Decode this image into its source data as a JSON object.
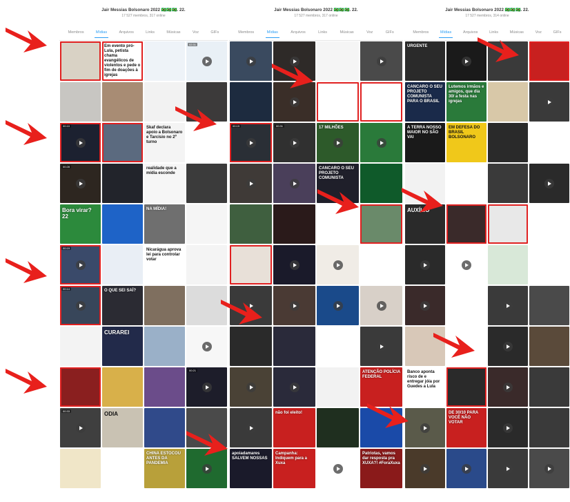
{
  "panels": [
    {
      "title": "Jair Messias Bolsonaro 2022 🇧🇷🇧🇷🇧🇷. 22.",
      "subtitle": "17 527 membros, 317 online",
      "tabs": [
        "Membros",
        "Mídias",
        "Arquivos",
        "Links",
        "Músicas",
        "Voz",
        "GIFs"
      ],
      "active_tab": "Mídias",
      "cells": [
        {
          "bg": "#d9d2c5",
          "text": "",
          "hl": true,
          "video": false
        },
        {
          "bg": "#ffffff",
          "text": "Em evento pró-Lula, petista chama evangélicos de violentos e pede o fim de doações à igrejas",
          "dark": true,
          "hl": true,
          "video": false
        },
        {
          "bg": "#eef3f8",
          "text": "",
          "video": false
        },
        {
          "bg": "#e9f0f6",
          "text": "",
          "video": true,
          "dur": "02:31"
        },
        {
          "bg": "#c8c6c2",
          "text": "",
          "video": false
        },
        {
          "bg": "#a88c74",
          "text": "",
          "video": false
        },
        {
          "bg": "#f2f2f2",
          "text": "",
          "video": false
        },
        {
          "bg": "#3c3a3a",
          "text": "",
          "video": false
        },
        {
          "bg": "#1c2130",
          "text": "",
          "video": true,
          "hl": true,
          "dur": "00:10"
        },
        {
          "bg": "#5b6a7f",
          "text": "",
          "hl": true,
          "video": false
        },
        {
          "bg": "#f4f4f4",
          "text": "Skaf declara apoio a Bolsonaro e Tarcísio no 2º turno",
          "dark": true,
          "video": false
        },
        {
          "bg": "#ffffff",
          "text": "",
          "video": false
        },
        {
          "bg": "#2d2620",
          "text": "",
          "video": true,
          "dur": "00:28"
        },
        {
          "bg": "#22242b",
          "text": "",
          "video": false
        },
        {
          "bg": "#f6f6f6",
          "text": "realidade que a mídia esconde",
          "dark": true,
          "video": false
        },
        {
          "bg": "#3b3b3b",
          "text": "",
          "video": false
        },
        {
          "bg": "#2c8a3c",
          "text": "Bora virar? 22",
          "big": true,
          "video": false
        },
        {
          "bg": "#1e63c7",
          "text": "",
          "video": false
        },
        {
          "bg": "#6f6f6f",
          "text": "NA MÍDIA!",
          "video": false
        },
        {
          "bg": "#f5f5f5",
          "text": "",
          "video": false
        },
        {
          "bg": "#3a4a6a",
          "text": "",
          "hl": true,
          "video": true,
          "dur": "00:19"
        },
        {
          "bg": "#e9eef5",
          "text": "",
          "video": false
        },
        {
          "bg": "#ffffff",
          "text": "Nicarágua aprova lei para controlar votar",
          "dark": true,
          "video": false
        },
        {
          "bg": "#f4f4f4",
          "text": "",
          "video": false
        },
        {
          "bg": "#38465a",
          "text": "",
          "hl": true,
          "video": true,
          "dur": "00:14"
        },
        {
          "bg": "#2b2b33",
          "text": "O QUE SEI SAÍ?",
          "video": false
        },
        {
          "bg": "#7f6f5f",
          "text": "",
          "video": false
        },
        {
          "bg": "#dcdcdc",
          "text": "",
          "video": false
        },
        {
          "bg": "#f3f3f3",
          "text": "",
          "video": false
        },
        {
          "bg": "#222a4a",
          "text": "CURAREI",
          "big": true,
          "video": false
        },
        {
          "bg": "#9ab0c8",
          "text": "",
          "video": false
        },
        {
          "bg": "#f7f7f7",
          "text": "",
          "video": true
        },
        {
          "bg": "#8a1f1f",
          "text": "",
          "hl": true,
          "video": false
        },
        {
          "bg": "#d8b04a",
          "text": "",
          "video": false
        },
        {
          "bg": "#6b4c8a",
          "text": "",
          "video": false
        },
        {
          "bg": "#1d1d2a",
          "text": "",
          "video": true,
          "dur": "00:21"
        },
        {
          "bg": "#3f3f3f",
          "text": "",
          "video": true,
          "dur": "00:33"
        },
        {
          "bg": "#c9c2b3",
          "text": "ODIA",
          "dark": true,
          "big": true,
          "video": false
        },
        {
          "bg": "#304a8a",
          "text": "",
          "video": false
        },
        {
          "bg": "#4a4a4a",
          "text": "",
          "video": false
        },
        {
          "bg": "#f0e6c8",
          "text": "",
          "video": false
        },
        {
          "bg": "#ffffff",
          "text": "",
          "video": false
        },
        {
          "bg": "#b8a03a",
          "text": "CHINA ESTOCOU ANTES DA PANDEMIA",
          "video": false
        },
        {
          "bg": "#1f6a2f",
          "text": "",
          "video": true
        }
      ]
    },
    {
      "title": "Jair Messias Bolsonaro 2022 🇧🇷🇧🇷🇧🇷. 22.",
      "subtitle": "17 527 membros, 317 online",
      "tabs": [
        "Membros",
        "Mídias",
        "Arquivos",
        "Links",
        "Músicas",
        "Voz",
        "GIFs"
      ],
      "active_tab": "Mídias",
      "cells": [
        {
          "bg": "#3a4a5f",
          "text": "",
          "video": true
        },
        {
          "bg": "#2e2a28",
          "text": "",
          "video": true
        },
        {
          "bg": "#f5f5f5",
          "text": "",
          "video": false
        },
        {
          "bg": "#4a4a4a",
          "text": "",
          "video": true
        },
        {
          "bg": "#1d2b3f",
          "text": "",
          "video": false
        },
        {
          "bg": "#3a2e28",
          "text": "",
          "video": true
        },
        {
          "bg": "#ffffff",
          "text": "",
          "hl": true,
          "video": false
        },
        {
          "bg": "#ffffff",
          "text": "",
          "hl": true,
          "video": false
        },
        {
          "bg": "#2a2f36",
          "text": "",
          "hl": true,
          "video": true,
          "dur": "00:19"
        },
        {
          "bg": "#303030",
          "text": "",
          "video": true,
          "dur": "00:31"
        },
        {
          "bg": "#2d5a2a",
          "text": "17 MILHÕES",
          "video": true
        },
        {
          "bg": "#2a7a3a",
          "text": "",
          "video": true
        },
        {
          "bg": "#3f3a37",
          "text": "",
          "video": true
        },
        {
          "bg": "#4a3f5a",
          "text": "",
          "video": true
        },
        {
          "bg": "#1f1f2a",
          "text": "CANCARO O SEU PROJETO COMUNISTA",
          "video": false
        },
        {
          "bg": "#0f5a2a",
          "text": "",
          "video": false
        },
        {
          "bg": "#3f5f3f",
          "text": "",
          "video": false
        },
        {
          "bg": "#2a1a1a",
          "text": "",
          "video": false
        },
        {
          "bg": "#ffffff",
          "text": "",
          "video": false
        },
        {
          "bg": "#6a8a6a",
          "text": "",
          "hl": true,
          "video": false
        },
        {
          "bg": "#e8e0d8",
          "text": "",
          "hl": true,
          "video": false
        },
        {
          "bg": "#1a1a2a",
          "text": "",
          "video": true
        },
        {
          "bg": "#f0ece6",
          "text": "",
          "video": true
        },
        {
          "bg": "#ffffff",
          "text": "",
          "video": false
        },
        {
          "bg": "#3a3a3a",
          "text": "",
          "video": true
        },
        {
          "bg": "#4a3a34",
          "text": "",
          "video": true
        },
        {
          "bg": "#1a4a8a",
          "text": "",
          "video": true
        },
        {
          "bg": "#d8d0c8",
          "text": "",
          "video": true
        },
        {
          "bg": "#2a2a2a",
          "text": "",
          "video": false
        },
        {
          "bg": "#2a2a3a",
          "text": "",
          "video": false
        },
        {
          "bg": "#ffffff",
          "text": "",
          "video": false
        },
        {
          "bg": "#3a3a3a",
          "text": "",
          "video": true
        },
        {
          "bg": "#4a4236",
          "text": "",
          "video": true
        },
        {
          "bg": "#2a2a3a",
          "text": "",
          "video": true
        },
        {
          "bg": "#f2f2f2",
          "text": "",
          "video": false
        },
        {
          "bg": "#c8201f",
          "text": "ATENÇÃO POLÍCIA FEDERAL",
          "video": false
        },
        {
          "bg": "#3a3a3a",
          "text": "",
          "video": true
        },
        {
          "bg": "#c8201f",
          "text": "não foi eleito!",
          "video": false
        },
        {
          "bg": "#1f2f1f",
          "text": "",
          "video": false
        },
        {
          "bg": "#1a4aa8",
          "text": "",
          "video": false
        },
        {
          "bg": "#1a1a2a",
          "text": "apoiadamares SALVEM NOSSAS",
          "video": false
        },
        {
          "bg": "#c8201f",
          "text": "Campanha: Indiquem para a Xuxa",
          "video": false
        },
        {
          "bg": "#ffffff",
          "text": "",
          "video": true
        },
        {
          "bg": "#8a1a1a",
          "text": "Patriotas, vamos dar resposta pra XUXA?! #ForaXuxa",
          "video": false
        }
      ]
    },
    {
      "title": "Jair Messias Bolsonaro 2022 🇧🇷🇧🇷🇧🇷. 22.",
      "subtitle": "17 527 membros, 314 online",
      "tabs": [
        "Membros",
        "Mídias",
        "Arquivos",
        "Links",
        "Músicas",
        "Voz",
        "GIFs"
      ],
      "active_tab": "Mídias",
      "cells": [
        {
          "bg": "#2a2a2a",
          "text": "URGENTE",
          "video": false
        },
        {
          "bg": "#1a1a1a",
          "text": "",
          "video": true
        },
        {
          "bg": "#3a3a3a",
          "text": "",
          "video": false
        },
        {
          "bg": "#c8201f",
          "text": "",
          "hl": true,
          "video": false
        },
        {
          "bg": "#1a2a4a",
          "text": "CANCARO O SEU PROJETO COMUNISTA PARA O BRASIL",
          "video": false
        },
        {
          "bg": "#2a7a3a",
          "text": "Lutemos irmãos e amigos, que dia 30/ a festa nas igrejas",
          "video": false
        },
        {
          "bg": "#d8c8a8",
          "text": "",
          "video": false
        },
        {
          "bg": "#3a3a3a",
          "text": "",
          "video": true
        },
        {
          "bg": "#1a1a1a",
          "text": "A TERRA NOSSO MAIOR NO SÃO VAI",
          "video": false
        },
        {
          "bg": "#f0c81a",
          "text": "EM DEFESA DO BRASIL BOLSONARO",
          "dark": true,
          "video": false
        },
        {
          "bg": "#2a2a2a",
          "text": "",
          "video": false
        },
        {
          "bg": "#ffffff",
          "text": "",
          "video": false
        },
        {
          "bg": "#f2f2f2",
          "text": "",
          "video": false
        },
        {
          "bg": "#ffffff",
          "text": "",
          "video": false
        },
        {
          "bg": "#3a3a3a",
          "text": "",
          "video": false
        },
        {
          "bg": "#2a2a2a",
          "text": "",
          "video": true
        },
        {
          "bg": "#2a2a2a",
          "text": "AUXÍLIO",
          "big": true,
          "video": false
        },
        {
          "bg": "#3a2a2a",
          "text": "",
          "hl": true,
          "video": false
        },
        {
          "bg": "#e8e8e8",
          "text": "",
          "hl": true,
          "video": false
        },
        {
          "bg": "#ffffff",
          "text": "",
          "video": false
        },
        {
          "bg": "#2a2a2a",
          "text": "",
          "video": true
        },
        {
          "bg": "#ffffff",
          "text": "",
          "video": true
        },
        {
          "bg": "#d8e8d8",
          "text": "",
          "video": false
        },
        {
          "bg": "#ffffff",
          "text": "",
          "video": false
        },
        {
          "bg": "#3a2a2a",
          "text": "",
          "video": true
        },
        {
          "bg": "#ffffff",
          "text": "",
          "video": false
        },
        {
          "bg": "#3a3a3a",
          "text": "",
          "video": true
        },
        {
          "bg": "#4a4a4a",
          "text": "",
          "video": false
        },
        {
          "bg": "#d8c8b8",
          "text": "",
          "video": false
        },
        {
          "bg": "#ffffff",
          "text": "",
          "video": false
        },
        {
          "bg": "#2a2a2a",
          "text": "",
          "video": true
        },
        {
          "bg": "#5a4a3a",
          "text": "",
          "video": false
        },
        {
          "bg": "#ffffff",
          "text": "Banco aponta risco de e entregar jóia por Guedes a Lula",
          "dark": true,
          "video": false
        },
        {
          "bg": "#2a2a2a",
          "text": "",
          "hl": true,
          "video": false
        },
        {
          "bg": "#3a2a2a",
          "text": "",
          "video": true
        },
        {
          "bg": "#3a3a3a",
          "text": "",
          "video": false
        },
        {
          "bg": "#5a5a4a",
          "text": "",
          "video": true
        },
        {
          "bg": "#c8201f",
          "text": "DE 30/10 PARA VOCÊ NÃO VOTAR",
          "video": false
        },
        {
          "bg": "#2a2a2a",
          "text": "",
          "video": true
        },
        {
          "bg": "#3a3a3a",
          "text": "",
          "video": false
        },
        {
          "bg": "#4a3a2a",
          "text": "",
          "video": true
        },
        {
          "bg": "#2a4a8a",
          "text": "",
          "video": true
        },
        {
          "bg": "#3a3a3a",
          "text": "",
          "video": true
        },
        {
          "bg": "#4a4a4a",
          "text": "",
          "video": true
        }
      ]
    }
  ]
}
